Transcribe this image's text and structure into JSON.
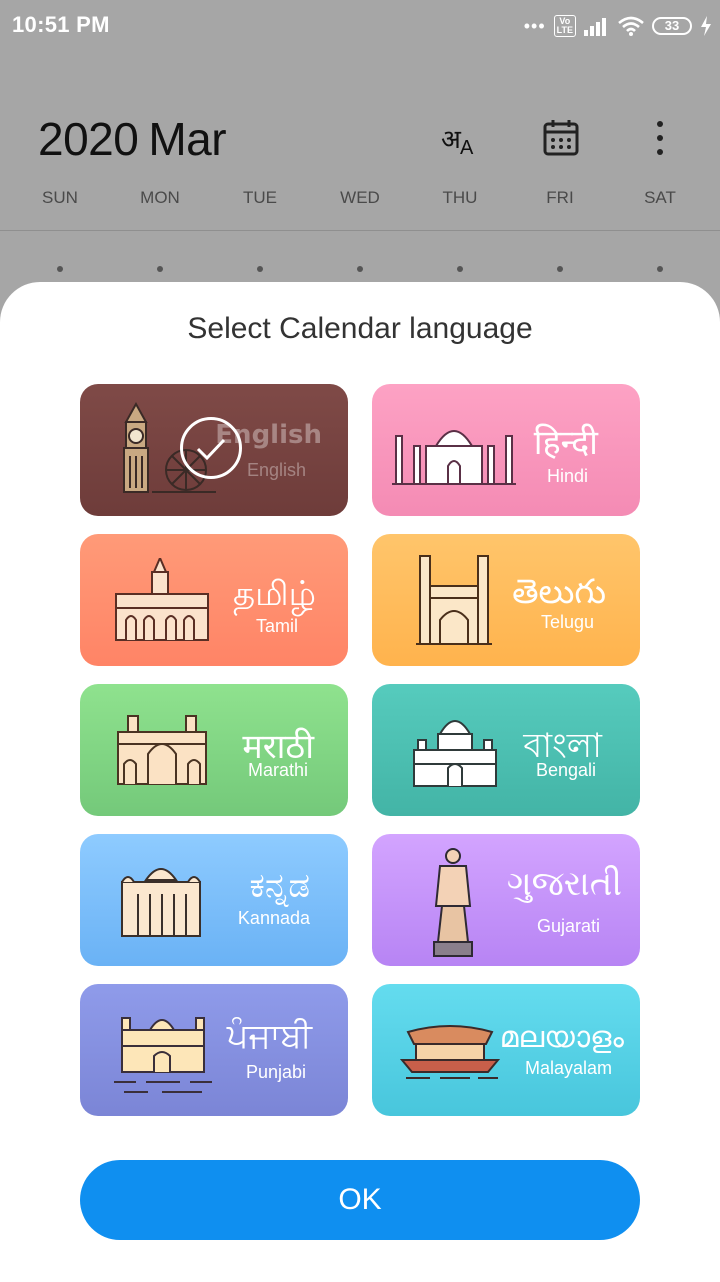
{
  "status_bar": {
    "time": "10:51 PM",
    "volte": "Vo\nLTE",
    "battery": "33"
  },
  "calendar": {
    "year": "2020",
    "month": "Mar",
    "weekdays": [
      "SUN",
      "MON",
      "TUE",
      "WED",
      "THU",
      "FRI",
      "SAT"
    ]
  },
  "sheet": {
    "title": "Select Calendar language",
    "ok_label": "OK",
    "selected": "English",
    "languages": [
      {
        "script": "English",
        "name": "English",
        "color_top": "#7f4a47",
        "color_bottom": "#6e3c3a"
      },
      {
        "script": "हिन्दी",
        "name": "Hindi",
        "color_top": "#fda2c4",
        "color_bottom": "#f48bb4"
      },
      {
        "script": "தமிழ்",
        "name": "Tamil",
        "color_top": "#ff9a78",
        "color_bottom": "#ff8466"
      },
      {
        "script": "తెలుగు",
        "name": "Telugu",
        "color_top": "#ffc56b",
        "color_bottom": "#ffb34d"
      },
      {
        "script": "मराठी",
        "name": "Marathi",
        "color_top": "#8fe28e",
        "color_bottom": "#74c97a"
      },
      {
        "script": "বাংলা",
        "name": "Bengali",
        "color_top": "#56cbbd",
        "color_bottom": "#43b4a6"
      },
      {
        "script": "ಕನ್ನಡ",
        "name": "Kannada",
        "color_top": "#8ecbff",
        "color_bottom": "#6ab2f5"
      },
      {
        "script": "ગુજરાતી",
        "name": "Gujarati",
        "color_top": "#d3a4ff",
        "color_bottom": "#b784f4"
      },
      {
        "script": "ਪੰਜਾਬੀ",
        "name": "Punjabi",
        "color_top": "#8f9bea",
        "color_bottom": "#7b85d6"
      },
      {
        "script": "മലയാളം",
        "name": "Malayalam",
        "color_top": "#64dcef",
        "color_bottom": "#48c6dc"
      }
    ]
  },
  "icons": {
    "header": [
      "language-icon",
      "calendar-icon",
      "more-vert-icon"
    ],
    "cards": [
      "big-ben-icon",
      "taj-mahal-icon",
      "chennai-building-icon",
      "charminar-icon",
      "gateway-of-india-icon",
      "victoria-memorial-icon",
      "vidhana-soudha-icon",
      "statue-of-unity-icon",
      "golden-temple-icon",
      "houseboat-icon"
    ]
  }
}
